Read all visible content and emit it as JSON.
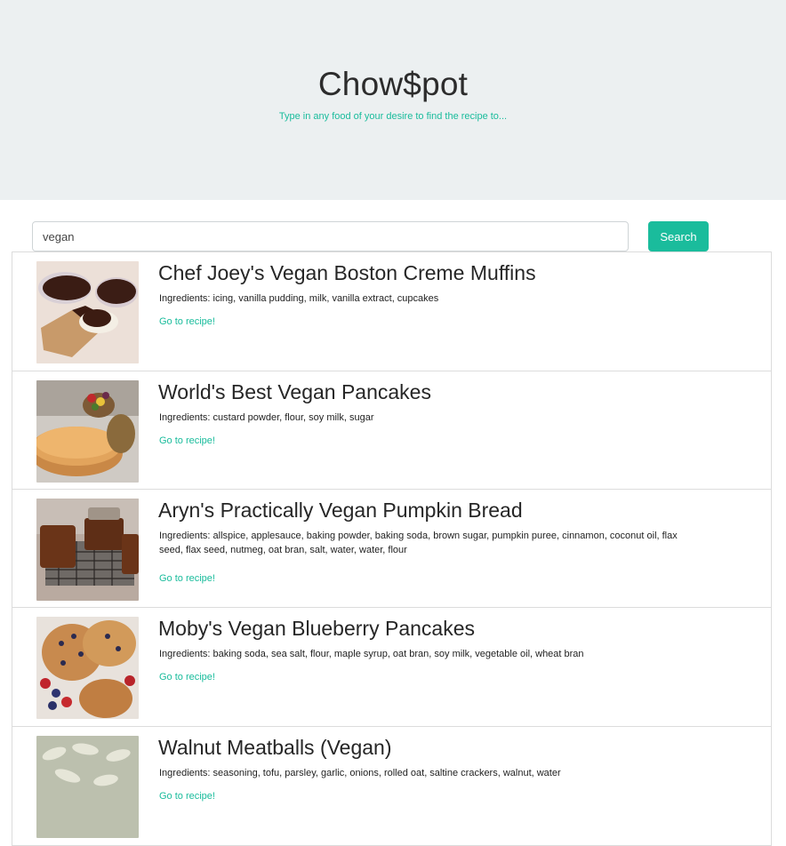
{
  "hero": {
    "title": "Chow$pot",
    "subtitle": "Type in any food of your desire to find the recipe to..."
  },
  "search": {
    "value": "vegan",
    "button_label": "Search"
  },
  "results": [
    {
      "title": "Chef Joey's Vegan Boston Creme Muffins",
      "ingredients": "Ingredients: icing, vanilla pudding, milk, vanilla extract, cupcakes",
      "link_label": "Go to recipe!",
      "image_icon": "muffins-photo"
    },
    {
      "title": "World's Best Vegan Pancakes",
      "ingredients": "Ingredients: custard powder, flour, soy milk, sugar",
      "link_label": "Go to recipe!",
      "image_icon": "pancakes-photo"
    },
    {
      "title": "Aryn's Practically Vegan Pumpkin Bread",
      "ingredients": "Ingredients: allspice, applesauce, baking powder, baking soda, brown sugar, pumpkin puree, cinnamon, coconut oil, flax seed, flax seed, nutmeg, oat bran, salt, water, water, flour",
      "link_label": "Go to recipe!",
      "image_icon": "pumpkin-bread-photo"
    },
    {
      "title": "Moby's Vegan Blueberry Pancakes",
      "ingredients": "Ingredients: baking soda, sea salt, flour, maple syrup, oat bran, soy milk, vegetable oil, wheat bran",
      "link_label": "Go to recipe!",
      "image_icon": "blueberry-pancakes-photo"
    },
    {
      "title": "Walnut Meatballs (Vegan)",
      "ingredients": "Ingredients: seasoning, tofu, parsley, garlic, onions, rolled oat, saltine crackers, walnut, water",
      "link_label": "Go to recipe!",
      "image_icon": "meatballs-photo"
    }
  ],
  "colors": {
    "accent": "#1abc9c",
    "hero_bg": "#ecf0f1"
  }
}
